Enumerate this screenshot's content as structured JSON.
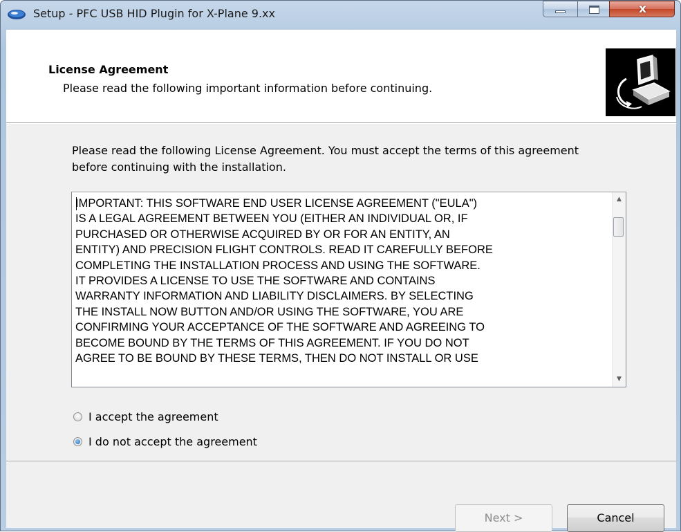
{
  "window": {
    "title": "Setup - PFC USB HID Plugin for X-Plane 9.xx",
    "icon": "setup-disk-icon",
    "controls": [
      "minimize-icon",
      "maximize-icon",
      "close-icon"
    ]
  },
  "header": {
    "title": "License Agreement",
    "subtitle": "Please read the following important information before continuing.",
    "image": "computer-install-icon"
  },
  "intro": {
    "text": "Please read the following License Agreement. You must accept the terms of this agreement before continuing with the installation."
  },
  "license": {
    "lines": [
      "IMPORTANT: THIS SOFTWARE END USER LICENSE AGREEMENT (\"EULA\")",
      "IS A LEGAL AGREEMENT BETWEEN YOU (EITHER AN INDIVIDUAL OR, IF",
      "PURCHASED OR OTHERWISE ACQUIRED BY OR FOR AN ENTITY, AN",
      "ENTITY) AND PRECISION FLIGHT CONTROLS. READ IT CAREFULLY BEFORE",
      "COMPLETING THE INSTALLATION PROCESS AND USING THE SOFTWARE.",
      "IT PROVIDES A LICENSE TO USE THE SOFTWARE AND CONTAINS",
      "WARRANTY INFORMATION AND LIABILITY DISCLAIMERS. BY SELECTING",
      "THE INSTALL NOW BUTTON AND/OR USING THE SOFTWARE, YOU ARE",
      "CONFIRMING YOUR ACCEPTANCE OF THE SOFTWARE AND AGREEING TO",
      "BECOME BOUND BY THE TERMS OF THIS AGREEMENT. IF YOU DO NOT",
      "AGREE TO BE BOUND BY THESE TERMS, THEN DO NOT INSTALL OR USE"
    ]
  },
  "options": {
    "accept": {
      "label": "I accept the agreement",
      "checked": false
    },
    "decline": {
      "label": "I do not accept the agreement",
      "checked": true
    }
  },
  "buttons": {
    "next": {
      "label": "Next >",
      "enabled": false
    },
    "cancel": {
      "label": "Cancel",
      "enabled": true
    }
  },
  "colors": {
    "title_bar": "#b9cde4",
    "close_button": "#c44727",
    "dialog_background": "#f0f0f0"
  }
}
